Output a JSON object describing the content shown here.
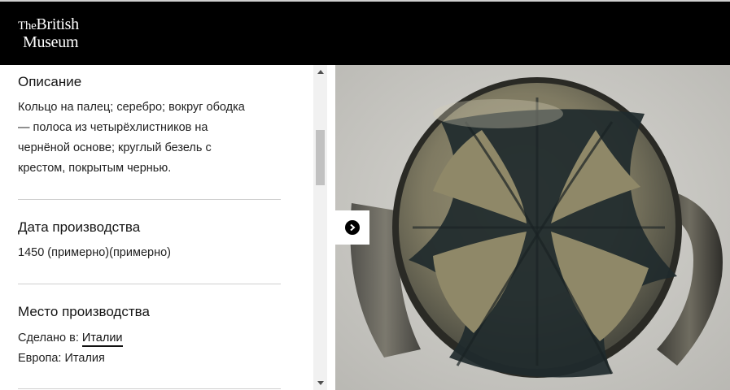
{
  "header": {
    "logo_line1_the": "The",
    "logo_line1_word": "British",
    "logo_line2": "Museum"
  },
  "description": {
    "heading": "Описание",
    "lines": [
      "Кольцо на палец; серебро; вокруг ободка",
      "— полоса из четырёхлистников на",
      "чернёной основе; круглый безель с",
      "крестом, покрытым чернью."
    ]
  },
  "production_date": {
    "heading": "Дата производства",
    "value": "1450 (примерно)(примерно)"
  },
  "production_place": {
    "heading": "Место производства",
    "made_in_label": "Сделано в:",
    "made_in_link": "Италии",
    "region": "Европа: Италия"
  },
  "image": {
    "subject": "silver ring with niello cross bezel"
  },
  "icons": {
    "next": "chevron-right-icon",
    "scroll_up": "scroll-up-arrow",
    "scroll_down": "scroll-down-arrow"
  },
  "colors": {
    "header_bg": "#000000",
    "scrollbar_track": "#f1f1f1",
    "scrollbar_thumb": "#c1c1c1"
  }
}
